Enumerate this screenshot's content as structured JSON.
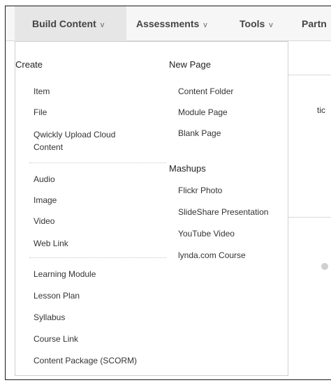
{
  "menubar": {
    "tabs": [
      {
        "label": "Build Content",
        "chevron": "v"
      },
      {
        "label": "Assessments",
        "chevron": "v"
      },
      {
        "label": "Tools",
        "chevron": "v"
      },
      {
        "label": "Partn",
        "chevron": ""
      }
    ]
  },
  "dropdown": {
    "create": {
      "header": "Create",
      "items": [
        "Item",
        "File",
        "Qwickly Upload Cloud Content",
        "Audio",
        "Image",
        "Video",
        "Web Link",
        "Learning Module",
        "Lesson Plan",
        "Syllabus",
        "Course Link",
        "Content Package (SCORM)"
      ]
    },
    "new_page": {
      "header": "New Page",
      "items": [
        "Content Folder",
        "Module Page",
        "Blank Page"
      ]
    },
    "mashups": {
      "header": "Mashups",
      "items": [
        "Flickr Photo",
        "SlideShare Presentation",
        "YouTube Video",
        "lynda.com Course"
      ]
    }
  },
  "background": {
    "fragment_text": "tic"
  }
}
